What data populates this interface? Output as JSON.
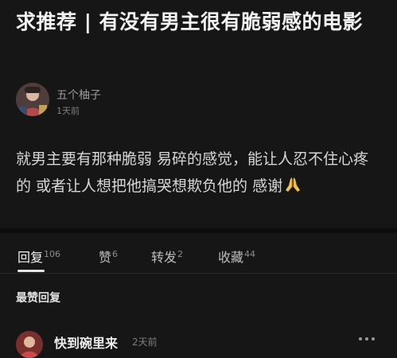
{
  "post": {
    "title": "求推荐 | 有没有男主很有脆弱感的电影",
    "author_name": "五个柚子",
    "time": "1天前",
    "body": "就男主要有那种脆弱 易碎的感觉，能让人忍不住心疼的 或者让人想把他搞哭想欺负他的 感谢",
    "body_emoji": "folded-hands-icon"
  },
  "tabs": [
    {
      "label": "回复",
      "count": "106",
      "active": true
    },
    {
      "label": "赞",
      "count": "6",
      "active": false
    },
    {
      "label": "转发",
      "count": "2",
      "active": false
    },
    {
      "label": "收藏",
      "count": "44",
      "active": false
    }
  ],
  "replies": {
    "heading": "最赞回复",
    "items": [
      {
        "name": "快到碗里来",
        "time": "2天前"
      }
    ]
  },
  "colors": {
    "background": "#161616",
    "text_primary": "#f2f2f2",
    "text_secondary": "#9a9a9a"
  }
}
